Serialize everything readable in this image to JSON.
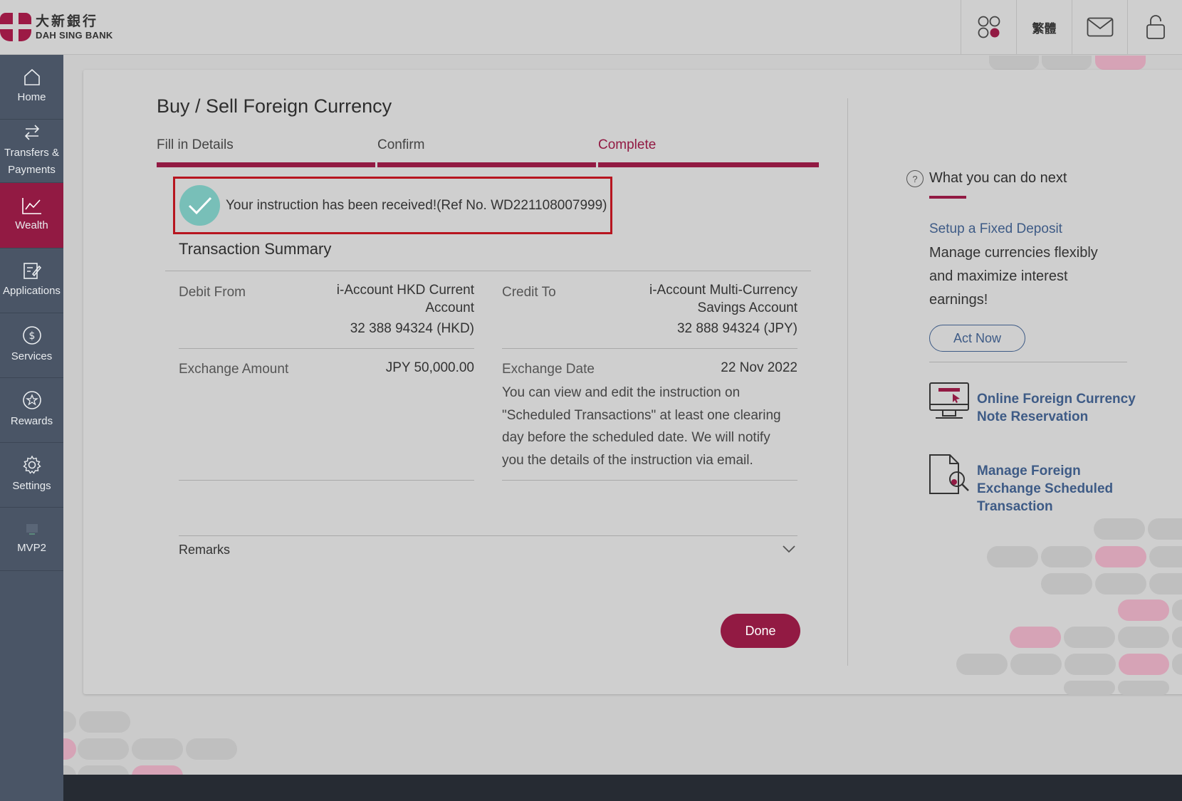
{
  "header": {
    "logo_cn": "大新銀行",
    "logo_en": "DAH SING BANK",
    "lang_label": "繁體"
  },
  "sidebar": {
    "items": [
      {
        "label": "Home"
      },
      {
        "label": "Transfers &",
        "label2": "Payments"
      },
      {
        "label": "Wealth"
      },
      {
        "label": "Applications"
      },
      {
        "label": "Services"
      },
      {
        "label": "Rewards"
      },
      {
        "label": "Settings"
      },
      {
        "label": "MVP2"
      }
    ]
  },
  "main": {
    "title": "Buy / Sell Foreign Currency",
    "steps": [
      "Fill in Details",
      "Confirm",
      "Complete"
    ],
    "success_message": "Your instruction has been received!(Ref No. WD221108007999)",
    "summary_title": "Transaction Summary",
    "debit_from": {
      "label": "Debit From",
      "line1": "i-Account HKD Current",
      "line2": "Account",
      "line3": "32 388 94324 (HKD)"
    },
    "credit_to": {
      "label": "Credit To",
      "line1": "i-Account Multi-Currency",
      "line2": "Savings Account",
      "line3": "32 888 94324 (JPY)"
    },
    "exchange_amount": {
      "label": "Exchange Amount",
      "value": "JPY 50,000.00"
    },
    "exchange_date": {
      "label": "Exchange Date",
      "value": "22 Nov 2022",
      "note": "You can view and edit the instruction on \"Scheduled Transactions\" at least one clearing day before the scheduled date. We will notify you the details of the instruction via email."
    },
    "remarks_label": "Remarks",
    "done_label": "Done"
  },
  "right_panel": {
    "title": "What you can do next",
    "fd_link": "Setup a Fixed Deposit",
    "fd_desc": "Manage currencies flexibly and maximize interest earnings!",
    "act_now": "Act Now",
    "link1_line1": "Online Foreign Currency",
    "link1_line2": "Note Reservation",
    "link2_line1": "Manage Foreign",
    "link2_line2": "Exchange Scheduled",
    "link2_line3": "Transaction"
  },
  "colors": {
    "brand": "#921a43",
    "link": "#3e5b86",
    "sidebar": "#4a5566",
    "check": "#78bfb8",
    "highlight_border": "#b7151f"
  },
  "icons": [
    "apps-icon",
    "mail-icon",
    "lock-icon",
    "home-icon",
    "transfer-icon",
    "chart-icon",
    "edit-icon",
    "dollar-icon",
    "star-icon",
    "gear-icon",
    "check-icon",
    "chevron-down-icon",
    "help-icon",
    "monitor-icon",
    "document-search-icon"
  ]
}
